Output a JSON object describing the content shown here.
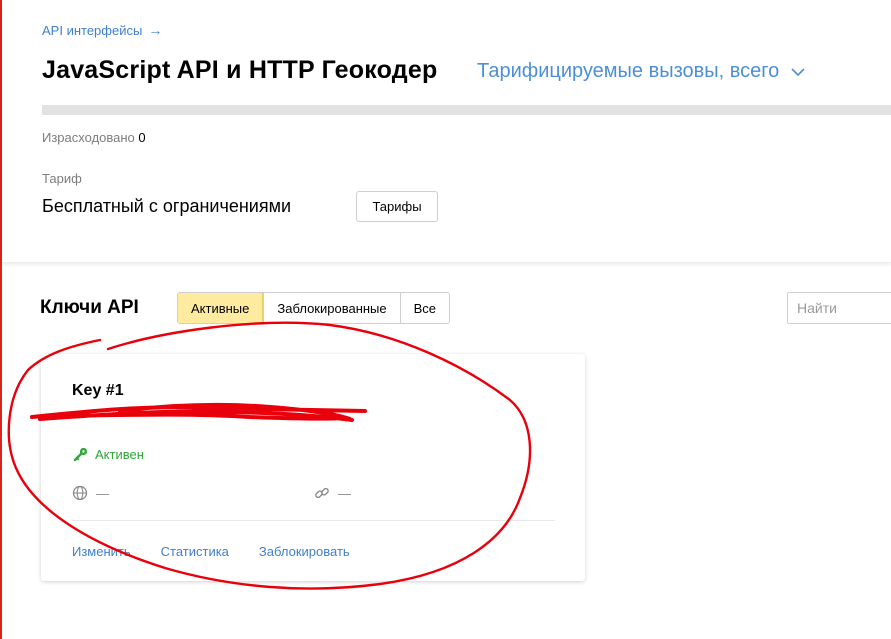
{
  "breadcrumb": {
    "label": "API интерфейсы",
    "arrow": "→"
  },
  "page_title": "JavaScript API и HTTP Геокодер",
  "metric_select": {
    "value": "Тарифицируемые вызовы, всего"
  },
  "usage": {
    "label": "Израсходовано",
    "value": "0",
    "progress_fraction": 0
  },
  "tariff": {
    "label": "Тариф",
    "name": "Бесплатный с ограничениями",
    "button_label": "Тарифы"
  },
  "keys_section": {
    "title": "Ключи API",
    "filters": [
      "Активные",
      "Заблокированные",
      "Все"
    ],
    "active_filter": "Активные",
    "search_placeholder": "Найти"
  },
  "key_card": {
    "name": "Key #1",
    "status": "Активен",
    "domain_value": "—",
    "referer_value": "—",
    "actions": [
      "Изменить",
      "Статистика",
      "Заблокировать"
    ]
  },
  "icons": {
    "status": "key-icon",
    "domain": "globe-icon",
    "referer": "link-icon",
    "dropdown": "chevron-down-icon"
  },
  "colors": {
    "link": "#3f7fce",
    "active_filter_bg": "#ffeba0",
    "status_green": "#2fa838",
    "annotation_red": "#e8000b"
  }
}
